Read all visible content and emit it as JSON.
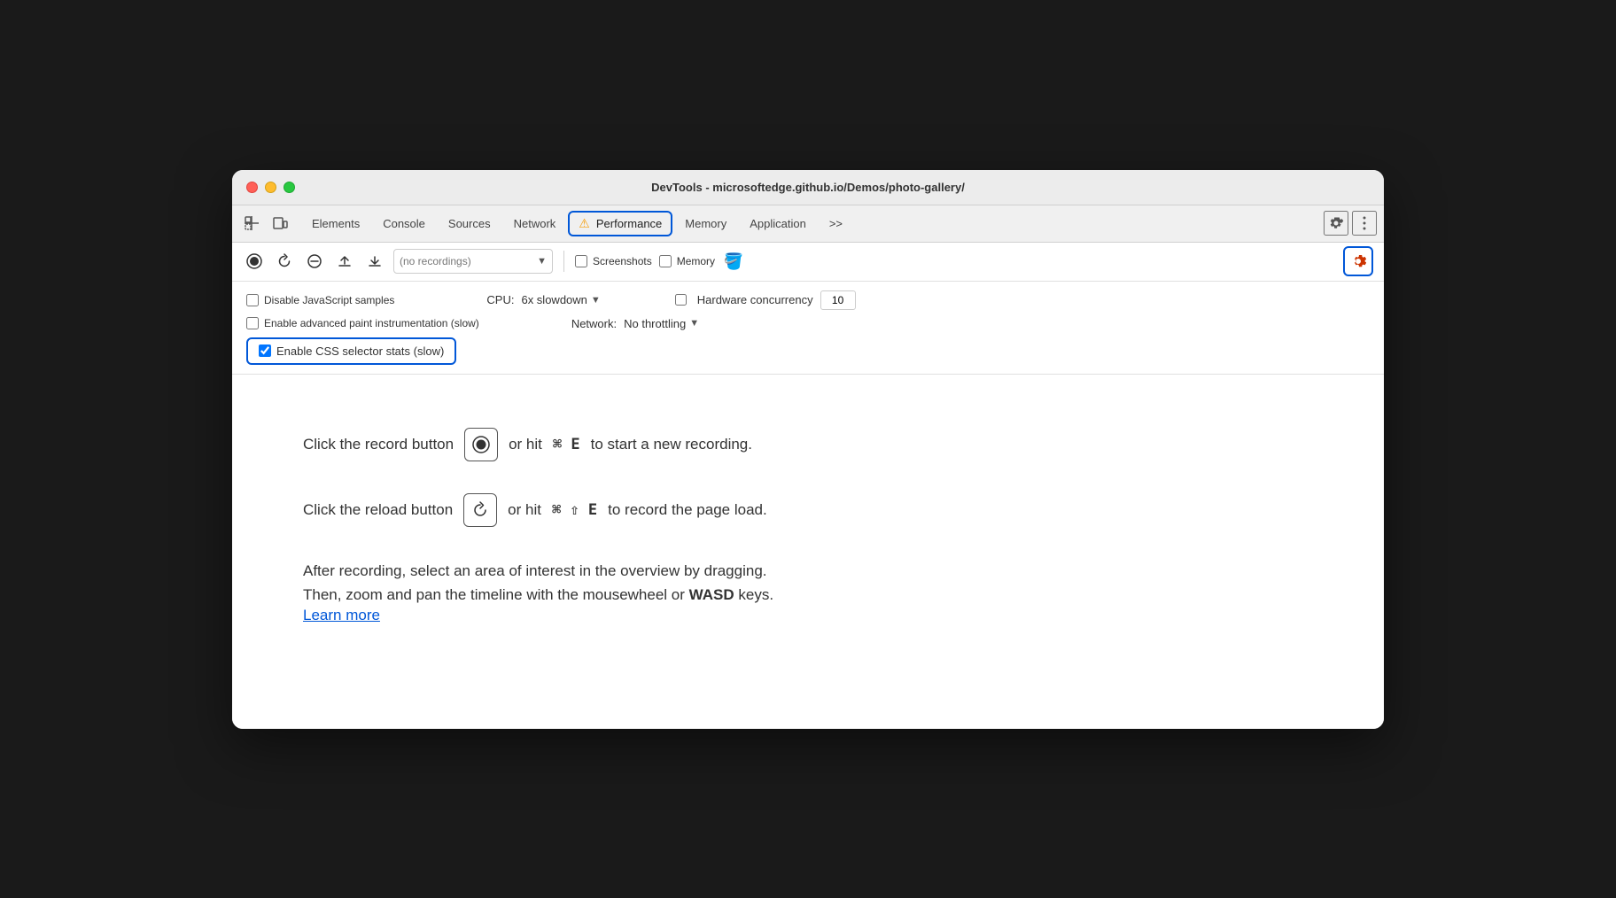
{
  "window": {
    "title": "DevTools - microsoftedge.github.io/Demos/photo-gallery/"
  },
  "tabs": {
    "items": [
      {
        "id": "elements",
        "label": "Elements"
      },
      {
        "id": "console",
        "label": "Console"
      },
      {
        "id": "sources",
        "label": "Sources"
      },
      {
        "id": "network",
        "label": "Network"
      },
      {
        "id": "performance",
        "label": "Performance",
        "active": true,
        "warning": true
      },
      {
        "id": "memory",
        "label": "Memory"
      },
      {
        "id": "application",
        "label": "Application"
      },
      {
        "id": "more",
        "label": ">>"
      }
    ]
  },
  "perf_toolbar": {
    "recordings_placeholder": "(no recordings)",
    "screenshots_label": "Screenshots",
    "memory_label": "Memory"
  },
  "settings": {
    "disable_js_samples": {
      "label": "Disable JavaScript samples",
      "checked": false
    },
    "enable_advanced_paint": {
      "label": "Enable advanced paint instrumentation (slow)",
      "checked": false
    },
    "enable_css_selector_stats": {
      "label": "Enable CSS selector stats (slow)",
      "checked": true
    },
    "cpu": {
      "label": "CPU:",
      "value": "6x slowdown"
    },
    "network": {
      "label": "Network:",
      "value": "No throttling"
    },
    "hw_concurrency": {
      "label": "Hardware concurrency",
      "value": "10"
    }
  },
  "main": {
    "instruction1": {
      "text_before": "Click the record button",
      "text_after": "or hit",
      "shortcut": "⌘ E",
      "text_end": "to start a new recording."
    },
    "instruction2": {
      "text_before": "Click the reload button",
      "text_after": "or hit",
      "shortcut": "⌘ ⇧ E",
      "text_end": "to record the page load."
    },
    "instruction3": {
      "line1": "After recording, select an area of interest in the overview by dragging.",
      "line2_before": "Then, zoom and pan the timeline with the mousewheel or",
      "line2_bold": "WASD",
      "line2_after": "keys.",
      "learn_more": "Learn more"
    }
  },
  "icons": {
    "record": "⊙",
    "reload": "↺",
    "clear": "⊘",
    "upload": "⬆",
    "download": "⬇",
    "gear": "⚙",
    "more_vert": "⋮",
    "broom": "🖌",
    "settings_gear": "⚙"
  }
}
